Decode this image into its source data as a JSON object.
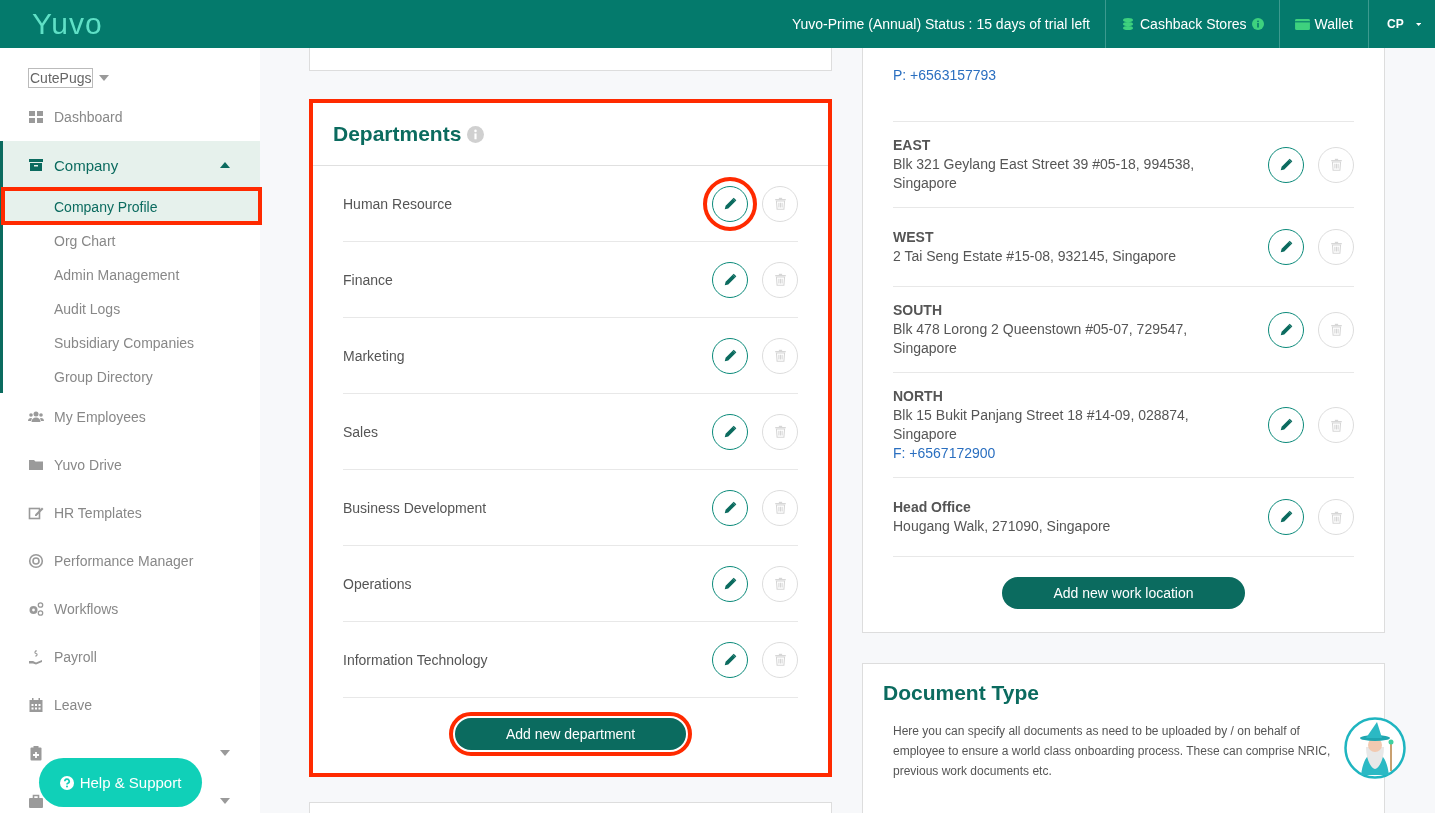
{
  "header": {
    "logo": "Yuvo",
    "status": "Yuvo-Prime (Annual) Status : 15 days of trial left",
    "links": [
      {
        "label": "Cashback Stores",
        "kind": "cashback"
      },
      {
        "label": "Wallet",
        "kind": "wallet"
      }
    ],
    "user": "CP"
  },
  "sidebar": {
    "company": "CutePugs",
    "items": [
      {
        "label": "Dashboard",
        "selected": false
      },
      {
        "label": "Company",
        "selected": true,
        "expanded": true,
        "children": [
          {
            "label": "Company Profile",
            "selected": true,
            "highlighted": true
          },
          {
            "label": "Org Chart",
            "selected": false,
            "highlighted": false
          },
          {
            "label": "Admin Management",
            "selected": false,
            "highlighted": false
          },
          {
            "label": "Audit Logs",
            "selected": false,
            "highlighted": false
          },
          {
            "label": "Subsidiary Companies",
            "selected": false,
            "highlighted": false
          },
          {
            "label": "Group Directory",
            "selected": false,
            "highlighted": false
          }
        ]
      },
      {
        "label": "My Employees",
        "selected": false
      },
      {
        "label": "Yuvo Drive",
        "selected": false
      },
      {
        "label": "HR Templates",
        "selected": false
      },
      {
        "label": "Performance Manager",
        "selected": false
      },
      {
        "label": "Workflows",
        "selected": false
      },
      {
        "label": "Payroll",
        "selected": false
      },
      {
        "label": "Leave",
        "selected": false
      },
      {
        "expanded": false
      },
      {
        "expanded": false
      }
    ]
  },
  "departments": {
    "title": "Departments",
    "highlighted": true,
    "rows": [
      {
        "name": "Human Resource",
        "edit_highlighted": true
      },
      {
        "name": "Finance",
        "edit_highlighted": false
      },
      {
        "name": "Marketing",
        "edit_highlighted": false
      },
      {
        "name": "Sales",
        "edit_highlighted": false
      },
      {
        "name": "Business Development",
        "edit_highlighted": false
      },
      {
        "name": "Operations",
        "edit_highlighted": false
      },
      {
        "name": "Information Technology",
        "edit_highlighted": false
      }
    ],
    "add_button": {
      "label": "Add new department",
      "highlighted": true
    }
  },
  "locations": {
    "rows": [
      {
        "phone": "P: +6563157793"
      },
      {
        "name": "EAST",
        "address": "Blk 321 Geylang East Street 39 #05-18, 994538, Singapore"
      },
      {
        "name": "WEST",
        "address": "2 Tai Seng Estate #15-08, 932145, Singapore"
      },
      {
        "name": "SOUTH",
        "address": "Blk 478 Lorong 2 Queenstown #05-07, 729547, Singapore"
      },
      {
        "name": "NORTH",
        "address": "Blk 15 Bukit Panjang Street 18 #14-09, 028874, Singapore",
        "phone": "F: +6567172900"
      },
      {
        "name": "Head Office",
        "address": "Hougang Walk, 271090, Singapore"
      }
    ],
    "add_button": "Add new work location"
  },
  "document_type": {
    "title": "Document Type",
    "description": "Here you can specify all documents as need to be uploaded by / on behalf of employee to ensure a world class onboarding process. These can comprise NRIC, previous work documents etc."
  },
  "help_button": "Help & Support"
}
